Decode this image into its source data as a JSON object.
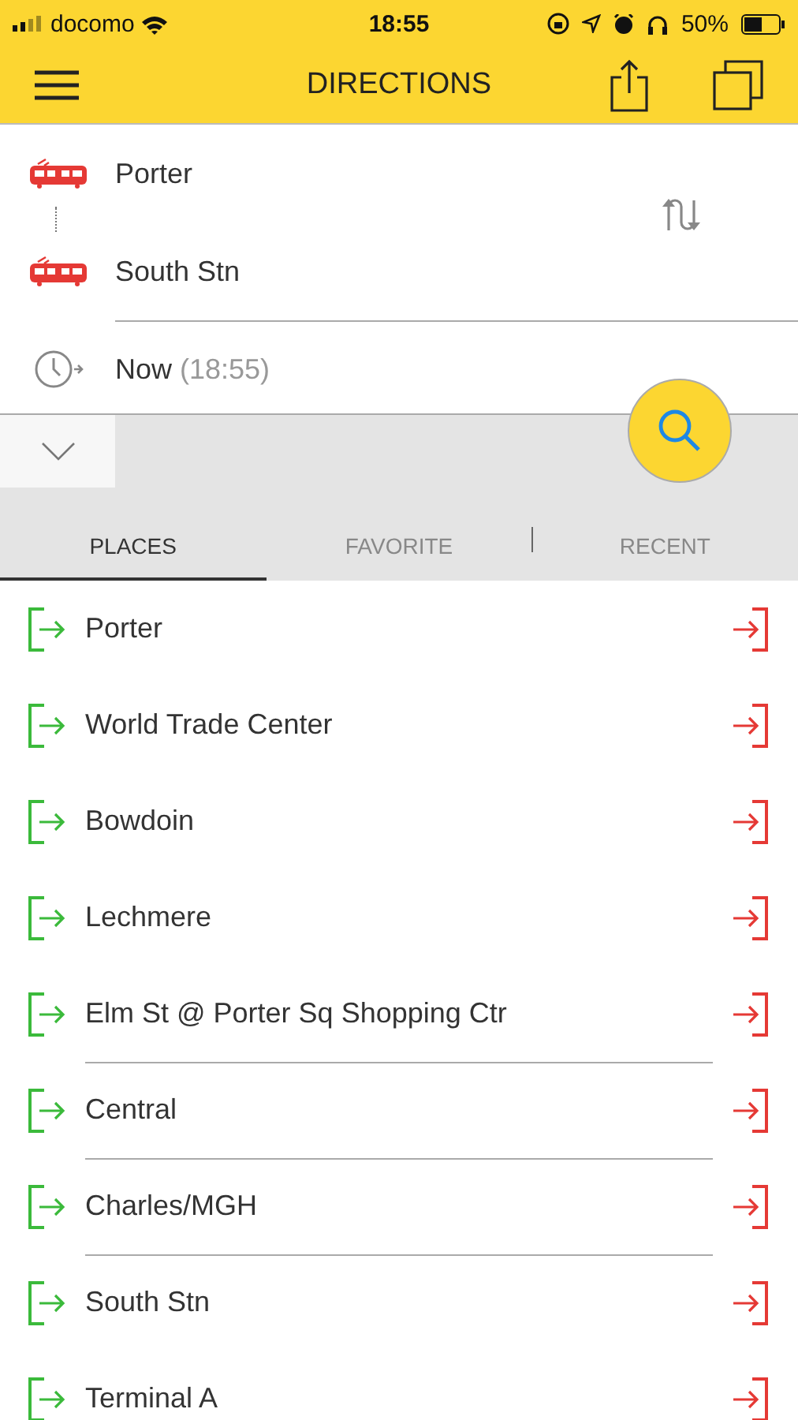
{
  "status_bar": {
    "carrier": "docomo",
    "time": "18:55",
    "battery": "50%"
  },
  "nav": {
    "title": "DIRECTIONS"
  },
  "route": {
    "from": "Porter",
    "to": "South Stn",
    "time_label": "Now",
    "time_value": "(18:55)"
  },
  "tabs": [
    {
      "label": "PLACES",
      "selected": true
    },
    {
      "label": "FAVORITE",
      "selected": false
    },
    {
      "label": "RECENT",
      "selected": false
    }
  ],
  "places": [
    {
      "name": "Porter",
      "divider": false
    },
    {
      "name": "World Trade Center",
      "divider": false
    },
    {
      "name": "Bowdoin",
      "divider": false
    },
    {
      "name": "Lechmere",
      "divider": false
    },
    {
      "name": "Elm St @ Porter Sq Shopping Ctr",
      "divider": false
    },
    {
      "name": "Central",
      "divider": true
    },
    {
      "name": "Charles/MGH",
      "divider": true
    },
    {
      "name": "South Stn",
      "divider": true
    },
    {
      "name": "Terminal A",
      "divider": false
    }
  ]
}
